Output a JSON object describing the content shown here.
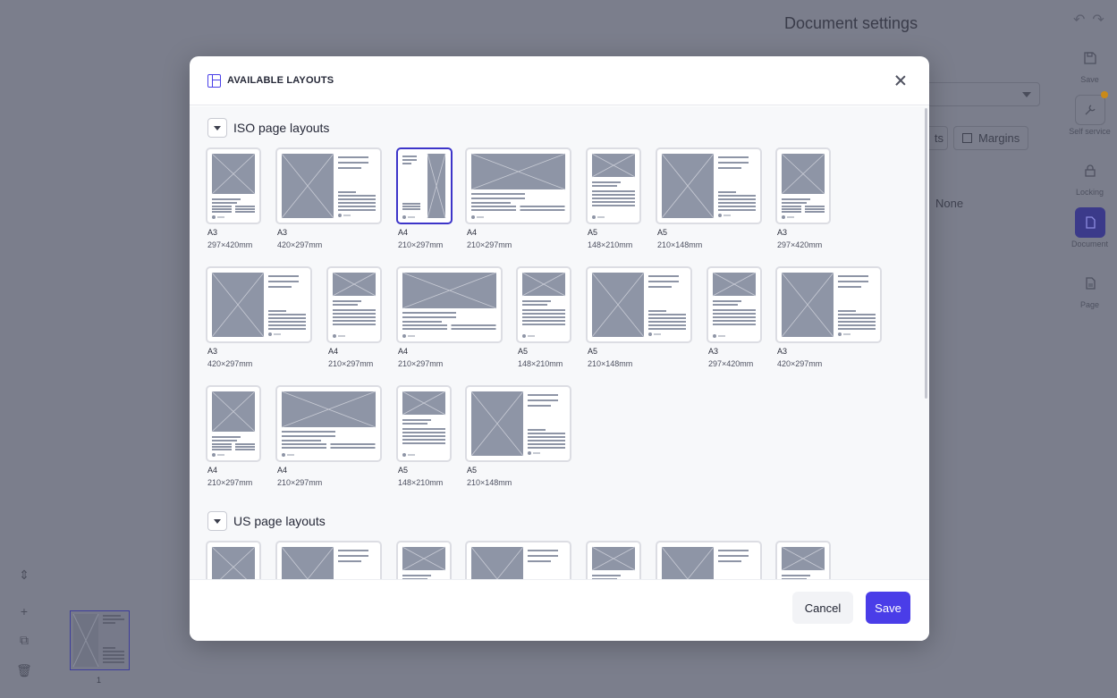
{
  "background": {
    "panel_title": "Document settings",
    "margins_label": "Margins",
    "none_label": "None",
    "rail": [
      {
        "label": "Save",
        "icon": "save-icon"
      },
      {
        "label": "Self service",
        "icon": "wrench-icon"
      },
      {
        "label": "Locking",
        "icon": "lock-icon"
      },
      {
        "label": "Document",
        "icon": "document-icon"
      },
      {
        "label": "Page",
        "icon": "page-icon"
      }
    ],
    "page_number": "1"
  },
  "modal": {
    "title": "AVAILABLE LAYOUTS",
    "sections": [
      {
        "title": "ISO page layouts",
        "layouts": [
          {
            "name": "A3",
            "size": "297×420mm",
            "kind": "portrait-a"
          },
          {
            "name": "A3",
            "size": "420×297mm",
            "kind": "land-side"
          },
          {
            "name": "A4",
            "size": "210×297mm",
            "kind": "portrait-side",
            "selected": true
          },
          {
            "name": "A4",
            "size": "210×297mm",
            "kind": "land-top"
          },
          {
            "name": "A5",
            "size": "148×210mm",
            "kind": "portrait-b"
          },
          {
            "name": "A5",
            "size": "210×148mm",
            "kind": "land-side"
          },
          {
            "name": "A3",
            "size": "297×420mm",
            "kind": "portrait-a"
          },
          {
            "name": "A3",
            "size": "420×297mm",
            "kind": "land-side"
          },
          {
            "name": "A4",
            "size": "210×297mm",
            "kind": "portrait-b"
          },
          {
            "name": "A4",
            "size": "210×297mm",
            "kind": "land-top"
          },
          {
            "name": "A5",
            "size": "148×210mm",
            "kind": "portrait-b"
          },
          {
            "name": "A5",
            "size": "210×148mm",
            "kind": "land-side"
          },
          {
            "name": "A3",
            "size": "297×420mm",
            "kind": "portrait-b"
          },
          {
            "name": "A3",
            "size": "420×297mm",
            "kind": "land-side"
          },
          {
            "name": "A4",
            "size": "210×297mm",
            "kind": "portrait-a"
          },
          {
            "name": "A4",
            "size": "210×297mm",
            "kind": "land-top"
          },
          {
            "name": "A5",
            "size": "148×210mm",
            "kind": "portrait-b"
          },
          {
            "name": "A5",
            "size": "210×148mm",
            "kind": "land-side"
          }
        ]
      },
      {
        "title": "US page layouts",
        "layouts": [
          {
            "kind": "portrait-a"
          },
          {
            "kind": "land-side"
          },
          {
            "kind": "portrait-b"
          },
          {
            "kind": "land-side"
          },
          {
            "kind": "portrait-b"
          },
          {
            "kind": "land-side"
          },
          {
            "kind": "portrait-b"
          }
        ]
      }
    ],
    "cancel_label": "Cancel",
    "save_label": "Save"
  },
  "colors": {
    "accent": "#4a3de8",
    "selected_border": "#3d35c9",
    "placeholder_fill": "#8e95a6",
    "overlay": "#7b7e8c"
  }
}
